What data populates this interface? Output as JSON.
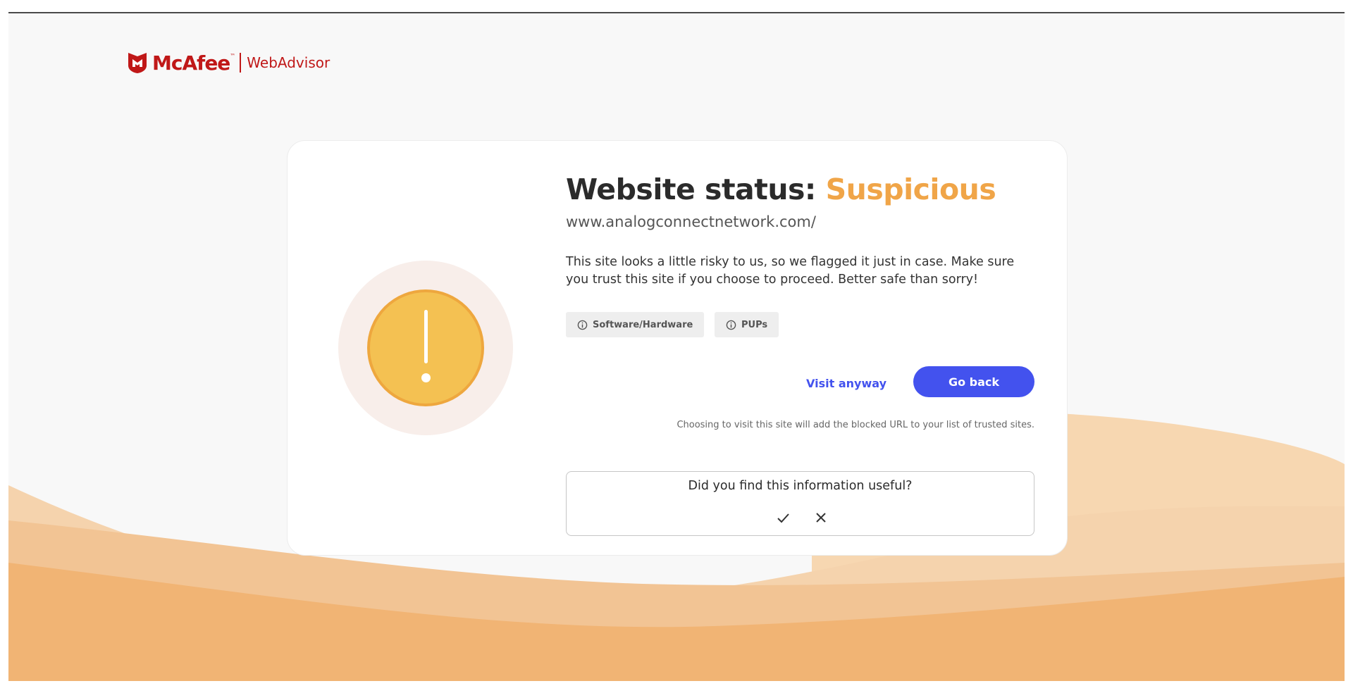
{
  "logo": {
    "brand": "McAfee",
    "trademark": "™",
    "product": "WebAdvisor"
  },
  "main": {
    "title_prefix": "Website status:",
    "status": "Suspicious",
    "url": "www.analogconnectnetwork.com/",
    "description": "This site looks a little risky to us, so we flagged it just in case. Make sure you trust this site if you choose to proceed. Better safe than sorry!",
    "tags": [
      {
        "label": "Software/Hardware",
        "icon": "info-icon"
      },
      {
        "label": "PUPs",
        "icon": "info-icon"
      }
    ],
    "visit_label": "Visit anyway",
    "goback_label": "Go back",
    "notice": "Choosing to visit this site will add the blocked URL to your list of trusted sites."
  },
  "feedback": {
    "question": "Did you find this information useful?",
    "yes_icon": "checkmark-icon",
    "no_icon": "close-icon"
  },
  "colors": {
    "brand_red": "#c01818",
    "status_orange": "#f0a548",
    "primary_blue": "#4352ee",
    "alert_yellow": "#f4c152",
    "wave_orange": "#f2b36e"
  }
}
